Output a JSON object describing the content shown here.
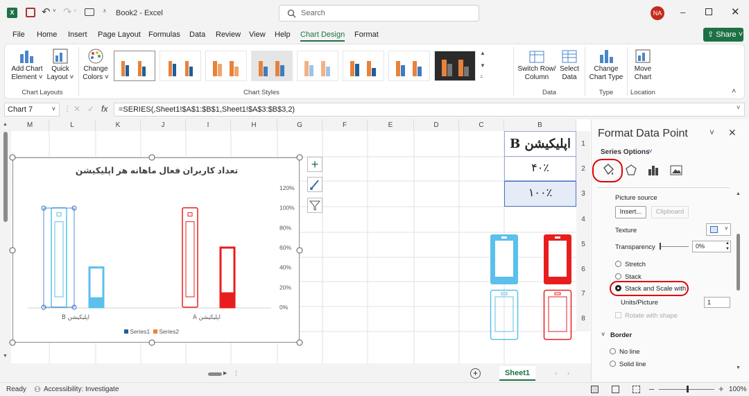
{
  "app": {
    "title": "Book2 - Excel",
    "user_initials": "NA",
    "search_placeholder": "Search",
    "share_label": "Share"
  },
  "colors": {
    "excel_green": "#1e7145",
    "series_blue": "#5bc0eb",
    "series_red": "#e81e1e",
    "highlight_red": "#e00000"
  },
  "menu": {
    "items": [
      "File",
      "Home",
      "Insert",
      "Page Layout",
      "Formulas",
      "Data",
      "Review",
      "View",
      "Help",
      "Chart Design",
      "Format"
    ],
    "active": "Chart Design"
  },
  "ribbon": {
    "add_chart_element": [
      "Add Chart",
      "Element ˅"
    ],
    "quick_layout": [
      "Quick",
      "Layout ˅"
    ],
    "change_colors": [
      "Change",
      "Colors ˅"
    ],
    "switch_row_col": [
      "Switch Row/",
      "Column"
    ],
    "select_data": [
      "Select",
      "Data"
    ],
    "change_chart_type": [
      "Change",
      "Chart Type"
    ],
    "move_chart": [
      "Move",
      "Chart"
    ],
    "groups": {
      "chart_layouts": "Chart Layouts",
      "chart_styles": "Chart Styles",
      "data": "Data",
      "type": "Type",
      "location": "Location"
    }
  },
  "formula_bar": {
    "name_box": "Chart 7",
    "fx": "fx",
    "formula": "=SERIES(,Sheet1!$A$1:$B$1,Sheet1!$A$3:$B$3,2)"
  },
  "grid": {
    "columns": [
      "M",
      "L",
      "K",
      "J",
      "I",
      "H",
      "G",
      "F",
      "E",
      "D",
      "C",
      "B"
    ],
    "rows": [
      "1",
      "2",
      "3",
      "4",
      "5",
      "6",
      "7",
      "8"
    ],
    "cells": {
      "B1": "اپلیکیشن B",
      "B2": "۴۰٪",
      "B3": "۱۰۰٪"
    }
  },
  "chart_data": {
    "type": "bar",
    "title": "تعداد کاربران فعال ماهانه هر اپلیکیشن",
    "categories": [
      "اپلیکیشن B",
      "اپلیکیشن A"
    ],
    "series": [
      {
        "name": "Series1",
        "values": [
          1.0,
          1.0
        ]
      },
      {
        "name": "Series2",
        "values": [
          0.4,
          0.6
        ]
      }
    ],
    "y_ticks": [
      "120%",
      "100%",
      "80%",
      "60%",
      "40%",
      "20%",
      "0%"
    ],
    "ylim": [
      0,
      1.2
    ],
    "y_axis_position": "right",
    "legend": "bottom",
    "grid": false
  },
  "chart_tools": [
    "add-element",
    "style",
    "filter"
  ],
  "pane": {
    "title": "Format Data Point",
    "series_options": "Series Options",
    "picture_source": "Picture source",
    "insert": "Insert...",
    "clipboard": "Clipboard",
    "texture": "Texture",
    "transparency": "Transparency",
    "transparency_value": "0%",
    "stretch": "Stretch",
    "stack": "Stack",
    "stack_scale": "Stack and Scale with",
    "units_picture": "Units/Picture",
    "units_value": "1",
    "rotate": "Rotate with shape",
    "border": "Border",
    "no_line": "No line",
    "solid_line": "Solid line"
  },
  "sheet": {
    "tab": "Sheet1"
  },
  "status": {
    "ready": "Ready",
    "accessibility": "Accessibility: Investigate",
    "zoom": "100%"
  }
}
